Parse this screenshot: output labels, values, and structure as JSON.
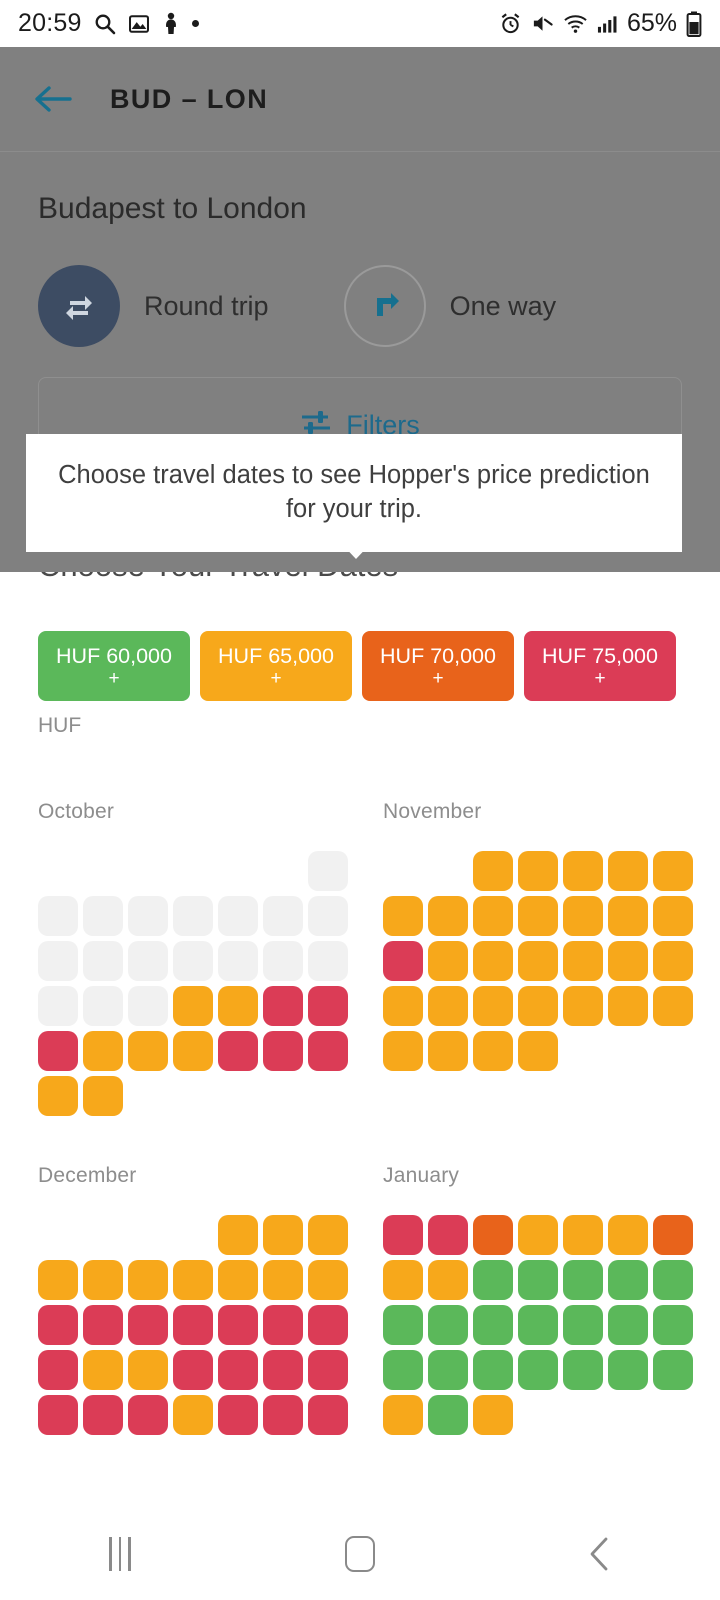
{
  "status_bar": {
    "time": "20:59",
    "left_icons": [
      "search-icon",
      "image-icon",
      "person-icon",
      "dot-icon"
    ],
    "right_icons": [
      "alarm-icon",
      "mute-icon",
      "wifi-icon",
      "cellular-signal-icon"
    ],
    "battery_percent": "65%"
  },
  "app_bar": {
    "back_icon": "back-arrow-icon",
    "title": "BUD – LON"
  },
  "search_panel": {
    "route_title": "Budapest to London",
    "trip_types": [
      {
        "label": "Round trip",
        "icon": "round-trip-icon",
        "selected": true
      },
      {
        "label": "One way",
        "icon": "one-way-arrow-icon",
        "selected": false
      }
    ],
    "filters": {
      "label": "Filters",
      "icon": "filters-sliders-icon"
    }
  },
  "tooltip": {
    "text": "Choose travel dates to see Hopper's price prediction for your trip."
  },
  "calendar_section": {
    "title": "Choose Your Travel Dates",
    "currency": "HUF",
    "legend": [
      {
        "amount": "HUF 60,000",
        "plus": "+",
        "color": "#5bb85a"
      },
      {
        "amount": "HUF 65,000",
        "plus": "+",
        "color": "#f7a81b"
      },
      {
        "amount": "HUF 70,000",
        "plus": "+",
        "color": "#e8631b"
      },
      {
        "amount": "HUF 75,000",
        "plus": "+",
        "color": "#db3c56"
      }
    ],
    "months": [
      {
        "name": "October",
        "rows": [
          [
            "empty",
            "empty",
            "empty",
            "empty",
            "empty",
            "empty",
            "grey"
          ],
          [
            "grey",
            "grey",
            "grey",
            "grey",
            "grey",
            "grey",
            "grey"
          ],
          [
            "grey",
            "grey",
            "grey",
            "grey",
            "grey",
            "grey",
            "grey"
          ],
          [
            "grey",
            "grey",
            "grey",
            "yellow",
            "yellow",
            "red",
            "red"
          ],
          [
            "red",
            "yellow",
            "yellow",
            "yellow",
            "red",
            "red",
            "red"
          ],
          [
            "yellow",
            "yellow"
          ]
        ]
      },
      {
        "name": "November",
        "rows": [
          [
            "empty",
            "empty",
            "yellow",
            "yellow",
            "yellow",
            "yellow",
            "yellow"
          ],
          [
            "yellow",
            "yellow",
            "yellow",
            "yellow",
            "yellow",
            "yellow",
            "yellow"
          ],
          [
            "red",
            "yellow",
            "yellow",
            "yellow",
            "yellow",
            "yellow",
            "yellow"
          ],
          [
            "yellow",
            "yellow",
            "yellow",
            "yellow",
            "yellow",
            "yellow",
            "yellow"
          ],
          [
            "yellow",
            "yellow",
            "yellow",
            "yellow"
          ]
        ]
      },
      {
        "name": "December",
        "rows": [
          [
            "empty",
            "empty",
            "empty",
            "empty",
            "yellow",
            "yellow",
            "yellow"
          ],
          [
            "yellow",
            "yellow",
            "yellow",
            "yellow",
            "yellow",
            "yellow",
            "yellow"
          ],
          [
            "red",
            "red",
            "red",
            "red",
            "red",
            "red",
            "red"
          ],
          [
            "red",
            "yellow",
            "yellow",
            "red",
            "red",
            "red",
            "red"
          ],
          [
            "red",
            "red",
            "red",
            "yellow",
            "red",
            "red",
            "red"
          ]
        ]
      },
      {
        "name": "January",
        "rows": [
          [
            "red",
            "red",
            "orange",
            "yellow",
            "yellow",
            "yellow",
            "orange"
          ],
          [
            "yellow",
            "yellow",
            "green",
            "green",
            "green",
            "green",
            "green"
          ],
          [
            "green",
            "green",
            "green",
            "green",
            "green",
            "green",
            "green"
          ],
          [
            "green",
            "green",
            "green",
            "green",
            "green",
            "green",
            "green"
          ],
          [
            "yellow",
            "green",
            "yellow"
          ]
        ]
      }
    ]
  },
  "nav_bar": {
    "recents_label": "recents-icon",
    "home_label": "home-icon",
    "back_label": "back-icon"
  }
}
